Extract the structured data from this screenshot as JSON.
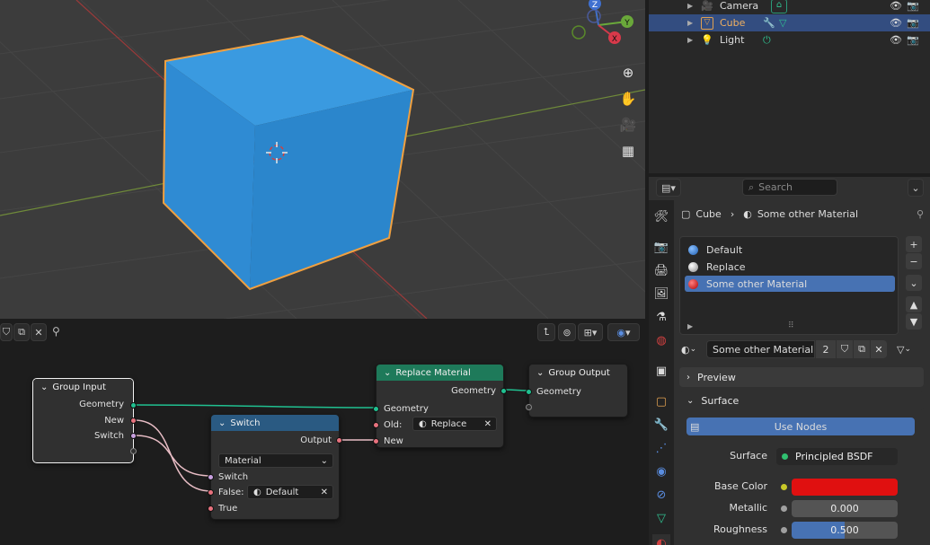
{
  "viewport": {
    "gizmo": {
      "z_label": "Z",
      "y_label": "Y",
      "x_label": "X"
    },
    "tools": {
      "zoom_icon": "zoom-icon",
      "pan_icon": "hand-icon",
      "camera_icon": "camera-icon",
      "perspective_icon": "grid-icon"
    }
  },
  "node_editor": {
    "group_input": {
      "title": "Group Input",
      "outputs": [
        "Geometry",
        "New",
        "Switch"
      ]
    },
    "switch": {
      "title": "Switch",
      "output": "Output",
      "type_value": "Material",
      "inputs": [
        "Switch",
        "False:",
        "True"
      ],
      "false_value": "Default"
    },
    "replace_material": {
      "title": "Replace Material",
      "output": "Geometry",
      "inputs": [
        "Geometry",
        "Old:",
        "New"
      ],
      "old_value": "Replace"
    },
    "group_output": {
      "title": "Group Output",
      "input": "Geometry"
    }
  },
  "outliner": {
    "rows": [
      {
        "name": "Camera"
      },
      {
        "name": "Cube"
      },
      {
        "name": "Light"
      }
    ]
  },
  "properties": {
    "search_placeholder": "Search",
    "breadcrumb": {
      "object": "Cube",
      "material": "Some other Material"
    },
    "material_slots": [
      "Default",
      "Replace",
      "Some other Material"
    ],
    "material_name": "Some other Material",
    "user_count": "2",
    "panels": {
      "preview": "Preview",
      "surface": "Surface"
    },
    "use_nodes_label": "Use Nodes",
    "surface": {
      "surface_label": "Surface",
      "surface_value": "Principled BSDF",
      "base_color_label": "Base Color",
      "metallic_label": "Metallic",
      "metallic_value": "0.000",
      "roughness_label": "Roughness",
      "roughness_value": "0.500"
    },
    "colors": {
      "accent": "#4772b3",
      "base_color": "#e01010",
      "cube": "#2e8fd6",
      "selection": "#f0a040"
    }
  }
}
